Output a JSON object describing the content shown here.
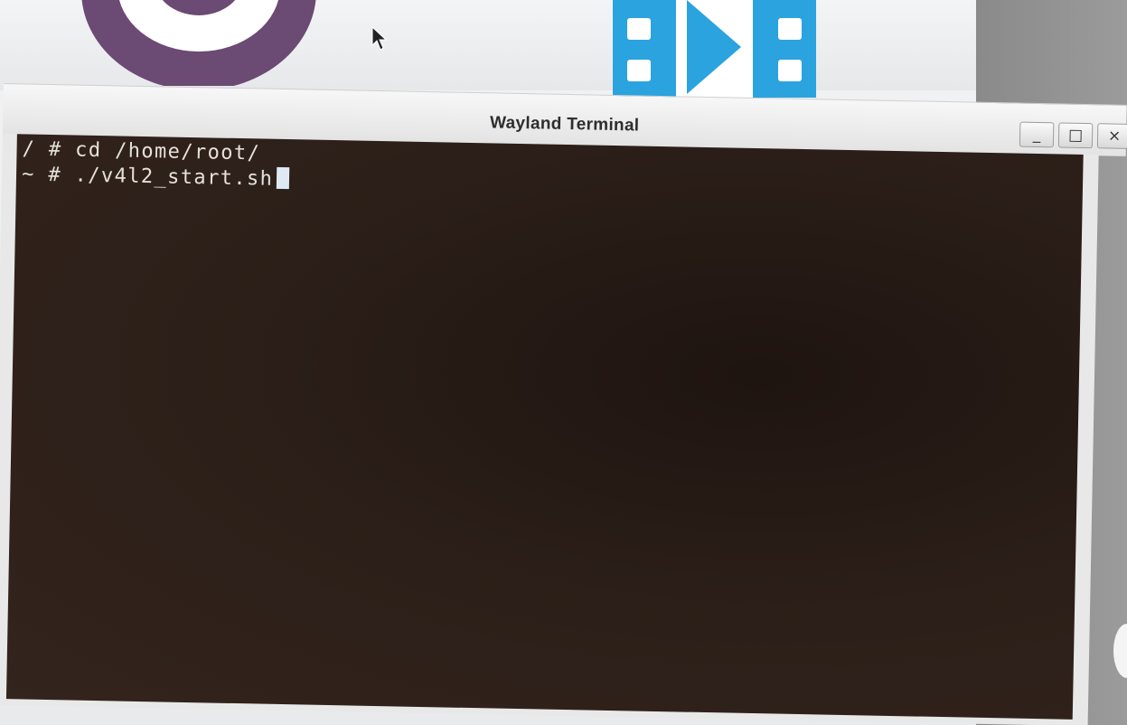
{
  "window": {
    "title": "Wayland Terminal",
    "buttons": {
      "minimize_glyph": "_",
      "maximize_glyph": "□",
      "close_glyph": "×"
    }
  },
  "terminal": {
    "lines": [
      {
        "prompt": "/ #",
        "command": "cd /home/root/"
      },
      {
        "prompt": "~ #",
        "command": "./v4l2_start.sh"
      }
    ]
  },
  "desktop": {
    "icons": [
      "app-ring-icon",
      "video-film-icon"
    ],
    "colors": {
      "ring_purple": "#6b4a73",
      "video_blue": "#2aa3df",
      "terminal_bg": "#2b1e18",
      "terminal_text": "#e6e1dc"
    }
  }
}
